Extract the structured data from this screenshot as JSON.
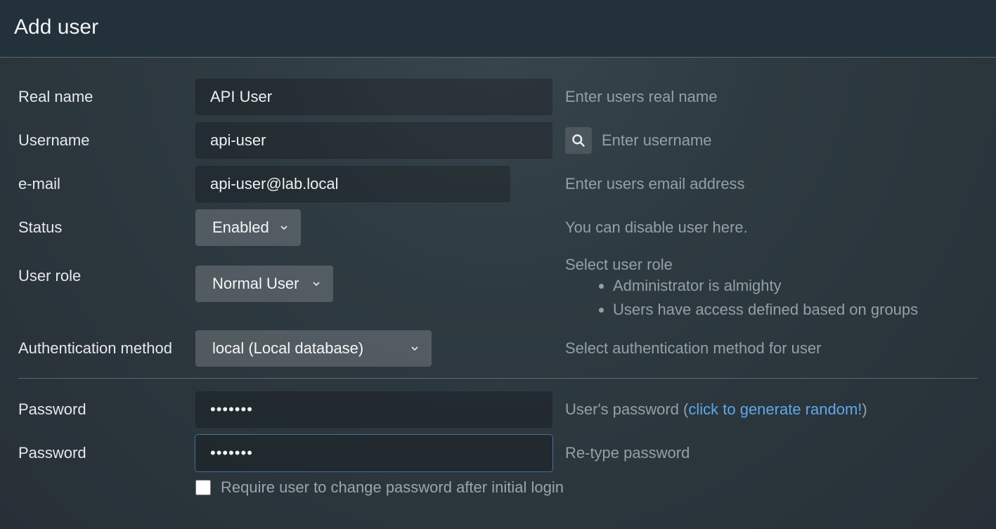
{
  "header": {
    "title": "Add user"
  },
  "labels": {
    "real_name": "Real name",
    "username": "Username",
    "email": "e-mail",
    "status": "Status",
    "user_role": "User role",
    "auth_method": "Authentication method",
    "password1": "Password",
    "password2": "Password"
  },
  "values": {
    "real_name": "API User",
    "username": "api-user",
    "email": "api-user@lab.local",
    "status": "Enabled",
    "user_role": "Normal User",
    "auth_method": "local (Local database)",
    "password1": "•••••••",
    "password2": "•••••••"
  },
  "help": {
    "real_name": "Enter users real name",
    "username": "Enter username",
    "email": "Enter users email address",
    "status": "You can disable user here.",
    "user_role_intro": "Select user role",
    "user_role_items": [
      "Administrator is almighty",
      "Users have access defined based on groups"
    ],
    "auth_method": "Select authentication method for user",
    "password1_prefix": "User's password (",
    "password1_link": "click to generate random!",
    "password1_suffix": ")",
    "password2": "Re-type password"
  },
  "checkbox": {
    "require_change": "Require user to change password after initial login",
    "checked": false
  },
  "icons": {
    "search": "search-icon",
    "caret": "chevron-down-icon"
  }
}
